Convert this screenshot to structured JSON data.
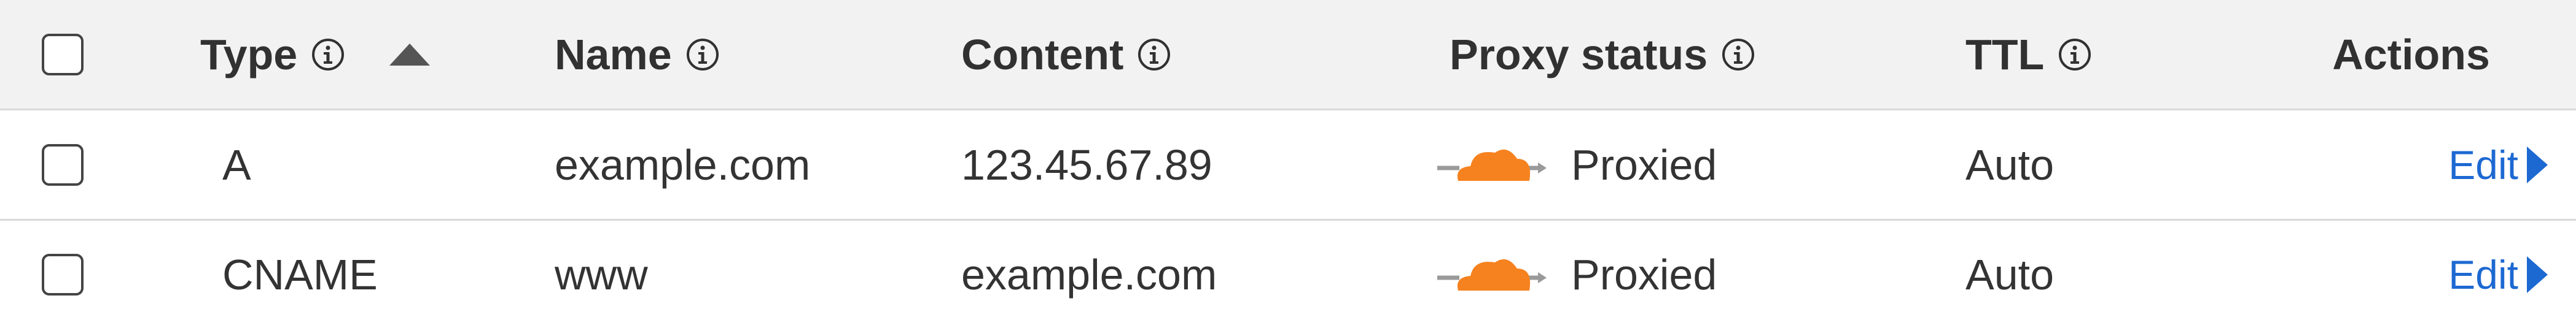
{
  "header": {
    "type_label": "Type",
    "name_label": "Name",
    "content_label": "Content",
    "proxy_label": "Proxy status",
    "ttl_label": "TTL",
    "actions_label": "Actions",
    "sort_direction": "ascending"
  },
  "rows": [
    {
      "type": "A",
      "name": "example.com",
      "content": "123.45.67.89",
      "proxy_status": "Proxied",
      "ttl": "Auto",
      "action": "Edit"
    },
    {
      "type": "CNAME",
      "name": "www",
      "content": "example.com",
      "proxy_status": "Proxied",
      "ttl": "Auto",
      "action": "Edit"
    }
  ],
  "colors": {
    "header_bg": "#f2f2f2",
    "link": "#1d69d2",
    "cloud_orange": "#f6821f",
    "divider": "#d9d9d9"
  },
  "icons": {
    "info": "info-icon",
    "sort": "sort-ascending-icon",
    "proxy": "orange-cloud-icon",
    "edit_caret": "caret-right-icon"
  }
}
